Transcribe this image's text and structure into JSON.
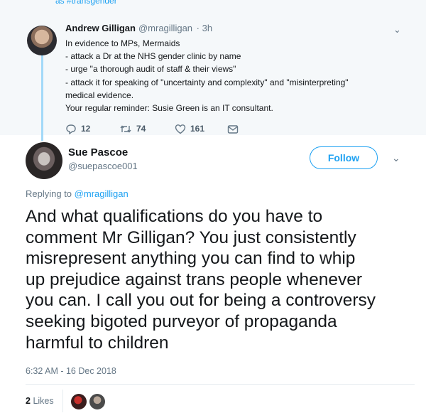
{
  "top_cut_text": "as #transgender",
  "quoted": {
    "name": "Andrew Gilligan",
    "handle": "@mragilligan",
    "time": "· 3h",
    "lines": [
      "In evidence to MPs, Mermaids",
      "- attack a Dr at the NHS gender clinic by name",
      "- urge \"a thorough audit of staff & their views\"",
      "- attack it for speaking of \"uncertainty and complexity\" and \"misinterpreting\"",
      "medical evidence.",
      "Your regular reminder: Susie Green is an IT consultant."
    ],
    "replies": "12",
    "retweets": "74",
    "likes": "161"
  },
  "tweet": {
    "name": "Sue Pascoe",
    "handle": "@suepascoe001",
    "follow_label": "Follow",
    "replying_prefix": "Replying to",
    "replying_to": "@mragilligan",
    "text_lines": [
      "And what qualifications do you have to",
      "comment Mr Gilligan? You just consistently",
      "misrepresent anything you can find to whip",
      "up prejudice against trans people whenever",
      "you can. I call you out for being a controversy",
      "seeking bigoted purveyor of propaganda",
      "harmful to children"
    ],
    "timestamp": "6:32 AM - 16 Dec 2018",
    "likes_count": "2",
    "likes_label": "Likes"
  },
  "colors": {
    "accent": "#1da1f2",
    "muted": "#657786",
    "thread": "#a3d9f8"
  }
}
